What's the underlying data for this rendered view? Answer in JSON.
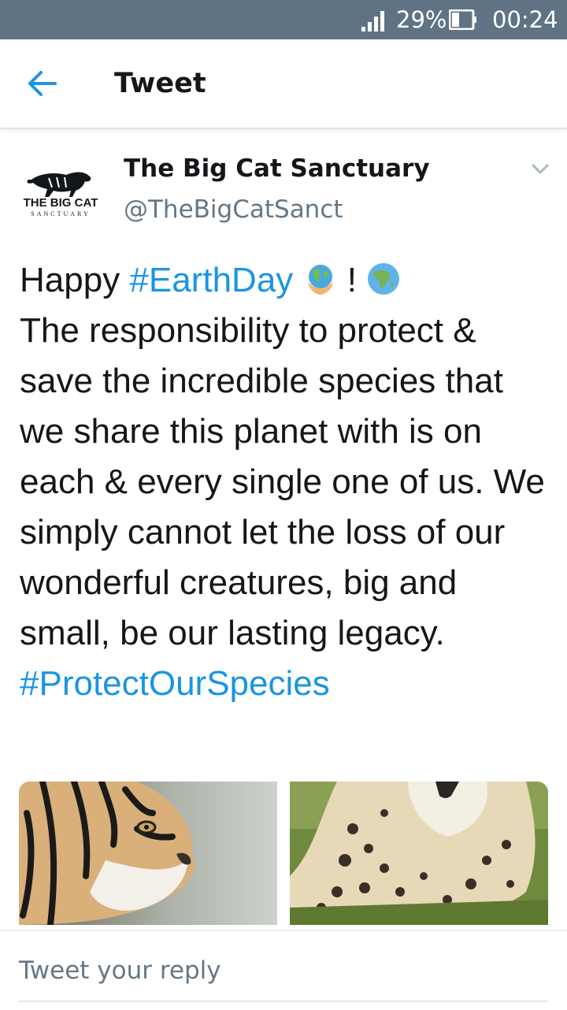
{
  "status_bar": {
    "battery_percent": "29%",
    "time": "00:24",
    "icons": [
      "signal-icon",
      "battery-icon"
    ]
  },
  "app_bar": {
    "title": "Tweet",
    "back_icon": "back-arrow-icon"
  },
  "tweet": {
    "author_name": "The Big Cat Sanctuary",
    "author_handle": "@TheBigCatSanct",
    "avatar_logo_text": "THE BIG CAT SANCTUARY",
    "text": {
      "happy": "Happy ",
      "hashtag_earthday": "#EarthDay",
      "exclaim": " ! ",
      "body": "The responsibility to protect & save the incredible species that we share this planet with is on each & every single one of us. We simply cannot let the loss of our wonderful creatures, big and small, be our lasting legacy.",
      "hashtag_protect": "#ProtectOurSpecies"
    },
    "emojis": [
      "earth-in-hands-emoji",
      "globe-africa-emoji"
    ],
    "media": [
      {
        "subject": "tiger-photo"
      },
      {
        "subject": "snow-leopard-photo"
      }
    ]
  },
  "reply": {
    "placeholder": "Tweet your reply"
  },
  "colors": {
    "status_bar": "#5f7385",
    "link": "#1b95e0",
    "text": "#14171a",
    "muted": "#657786"
  }
}
